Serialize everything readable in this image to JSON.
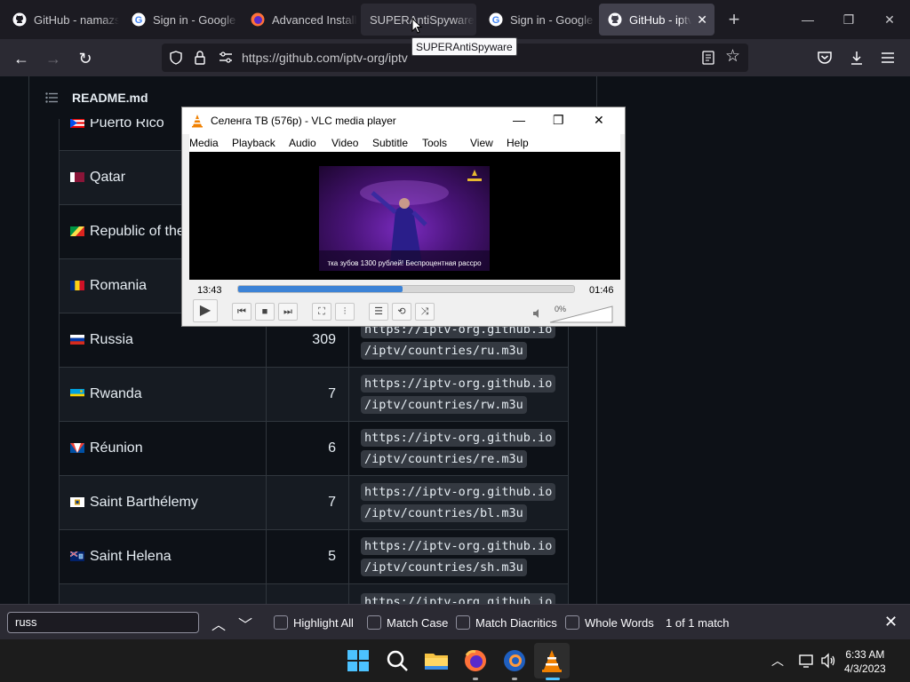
{
  "browser": {
    "tabs": [
      {
        "label": "GitHub - namazso",
        "icon": "github-icon"
      },
      {
        "label": "Sign in - Google Accounts",
        "icon": "google-icon"
      },
      {
        "label": "Advanced Installer",
        "icon": "firefox-icon"
      },
      {
        "label": "SUPERAntiSpyware",
        "icon": "none"
      },
      {
        "label": "Sign in - Google Accounts",
        "icon": "google-icon"
      },
      {
        "label": "GitHub - iptv-org/iptv",
        "icon": "github-icon"
      }
    ],
    "tooltip": "SUPERAntiSpyware",
    "url": "https://github.com/iptv-org/iptv"
  },
  "readme": {
    "title": "README.md",
    "rows": [
      {
        "country": "Puerto Rico",
        "count": "",
        "url1": "",
        "url2": ""
      },
      {
        "country": "Qatar",
        "count": "",
        "url1": "",
        "url2": ""
      },
      {
        "country": "Republic of the Congo",
        "count": "",
        "url1": "",
        "url2": ""
      },
      {
        "country": "Romania",
        "count": "",
        "url1": "",
        "url2": ""
      },
      {
        "country": "Russia",
        "count": "309",
        "url1": "https://iptv-org.github.io",
        "url2": "/iptv/countries/ru.m3u"
      },
      {
        "country": "Rwanda",
        "count": "7",
        "url1": "https://iptv-org.github.io",
        "url2": "/iptv/countries/rw.m3u"
      },
      {
        "country": "Réunion",
        "count": "6",
        "url1": "https://iptv-org.github.io",
        "url2": "/iptv/countries/re.m3u"
      },
      {
        "country": "Saint Barthélemy",
        "count": "7",
        "url1": "https://iptv-org.github.io",
        "url2": "/iptv/countries/bl.m3u"
      },
      {
        "country": "Saint Helena",
        "count": "5",
        "url1": "https://iptv-org.github.io",
        "url2": "/iptv/countries/sh.m3u"
      },
      {
        "country": "",
        "count": "",
        "url1": "https://iptv-org.github.io",
        "url2": ""
      }
    ]
  },
  "vlc": {
    "title": "Селенга ТВ (576p) - VLC media player",
    "menu": [
      "Media",
      "Playback",
      "Audio",
      "Video",
      "Subtitle",
      "Tools",
      "View",
      "Help"
    ],
    "elapsed": "13:43",
    "remaining": "01:46",
    "progress": 0.49,
    "volume": "0%",
    "subtitle_ticker": "тка зубов 1300 рублей! Беспроцентная рассро"
  },
  "findbar": {
    "query": "russ",
    "highlight_all": "Highlight All",
    "match_case": "Match Case",
    "match_diacritics": "Match Diacritics",
    "whole_words": "Whole Words",
    "result": "1 of 1 match"
  },
  "taskbar": {
    "time": "6:33 AM",
    "date": "4/3/2023"
  },
  "colors": {
    "accent_blue": "#3b82d6",
    "github_bg": "#0d1117",
    "firefox_chrome": "#2b2a33"
  }
}
